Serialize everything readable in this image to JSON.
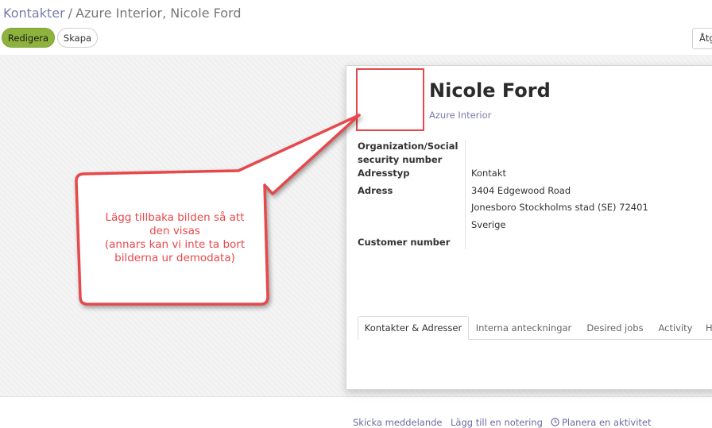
{
  "breadcrumb": {
    "parent": "Kontakter",
    "separator": "/",
    "current": "Azure Interior, Nicole Ford"
  },
  "toolbar": {
    "edit_label": "Redigera",
    "create_label": "Skapa",
    "action_label": "Åtg"
  },
  "partner": {
    "name": "Nicole Ford",
    "company": "Azure Interior",
    "fields": {
      "org_number_label_line1": "Organization/Social",
      "org_number_label_line2": "security number",
      "address_type_label": "Adresstyp",
      "address_type_value": "Kontakt",
      "address_label": "Adress",
      "address_line1": "3404 Edgewood Road",
      "address_line2": "Jonesboro  Stockholms stad (SE)  72401",
      "address_line3": "Sverige",
      "customer_number_label": "Customer number"
    }
  },
  "tabs": [
    {
      "label": "Kontakter & Adresser",
      "active": true
    },
    {
      "label": "Interna anteckningar",
      "active": false
    },
    {
      "label": "Desired jobs",
      "active": false
    },
    {
      "label": "Activity",
      "active": false
    },
    {
      "label": "H",
      "active": false
    }
  ],
  "chatter": {
    "send_message": "Skicka meddelande",
    "log_note": "Lägg till en notering",
    "schedule_activity": "Planera en aktivitet",
    "schedule_icon": "clock-icon"
  },
  "callout": {
    "line1": "Lägg tillbaka bilden så att",
    "line2": "den visas",
    "line3": "(annars kan vi inte ta bort",
    "line4": "bilderna ur demodata)"
  },
  "colors": {
    "primary_button": "#8db33d",
    "link": "#7c7bad",
    "annotation": "#e8484b"
  }
}
